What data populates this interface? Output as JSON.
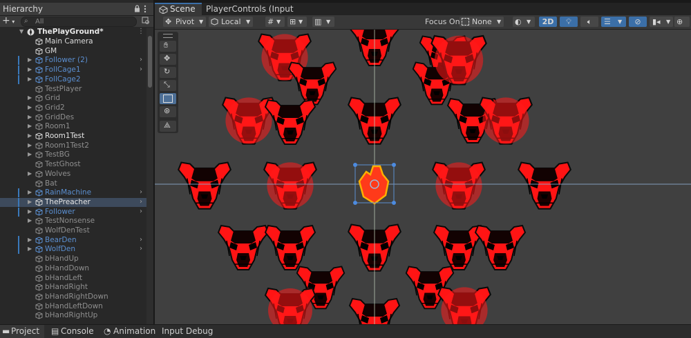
{
  "hierarchy": {
    "title": "Hierarchy",
    "add_label": "+",
    "search_placeholder": "All",
    "scene_name": "ThePlayGround*",
    "items": [
      {
        "label": "Main Camera",
        "style": "white"
      },
      {
        "label": "GM",
        "style": "white"
      },
      {
        "label": "Follower (2)",
        "style": "blue",
        "expand": true,
        "prefab": true
      },
      {
        "label": "FollCage1",
        "style": "blue",
        "expand": true,
        "prefab": true
      },
      {
        "label": "FollCage2",
        "style": "blue",
        "expand": false,
        "prefab": true
      },
      {
        "label": "TestPlayer",
        "style": "gray"
      },
      {
        "label": "Grid",
        "style": "gray",
        "expand": true
      },
      {
        "label": "Grid2",
        "style": "gray",
        "expand": true
      },
      {
        "label": "GridDes",
        "style": "gray",
        "expand": true
      },
      {
        "label": "Room1",
        "style": "gray",
        "expand": true
      },
      {
        "label": "Room1Test",
        "style": "bright",
        "expand": true
      },
      {
        "label": "Room1Test2",
        "style": "gray",
        "expand": true
      },
      {
        "label": "TestBG",
        "style": "gray",
        "expand": true
      },
      {
        "label": "TestGhost",
        "style": "gray"
      },
      {
        "label": "Wolves",
        "style": "gray",
        "expand": true
      },
      {
        "label": "Bat",
        "style": "gray"
      },
      {
        "label": "RainMachine",
        "style": "blue",
        "expand": true,
        "prefab": true
      },
      {
        "label": "ThePreacher",
        "style": "bright",
        "expand": true,
        "prefab": true,
        "selected": true
      },
      {
        "label": "Follower",
        "style": "blue",
        "expand": true,
        "prefab": true
      },
      {
        "label": "TestNonsense",
        "style": "gray",
        "expand": true
      },
      {
        "label": "WolfDenTest",
        "style": "gray"
      },
      {
        "label": "BearDen",
        "style": "blue",
        "expand": true,
        "prefab": true
      },
      {
        "label": "WolfDen",
        "style": "blue",
        "expand": true,
        "prefab": true
      },
      {
        "label": "bHandUp",
        "style": "gray"
      },
      {
        "label": "bHandDown",
        "style": "gray"
      },
      {
        "label": "bHandLeft",
        "style": "gray"
      },
      {
        "label": "bHandRight",
        "style": "gray"
      },
      {
        "label": "bHandRightDown",
        "style": "gray"
      },
      {
        "label": "bHandLeftDown",
        "style": "gray"
      },
      {
        "label": "bHandRightUp",
        "style": "gray"
      }
    ]
  },
  "scene_tabs": [
    {
      "label": "Scene",
      "active": true
    },
    {
      "label": "PlayerControls (Input Acti...",
      "active": false
    }
  ],
  "toolbar": {
    "pivot_label": "Pivot",
    "local_label": "Local",
    "focus_on_label": "Focus On",
    "none_label": "None",
    "mode_2d_label": "2D"
  },
  "bottom_tabs": [
    {
      "label": "Project",
      "icon": "folder-icon"
    },
    {
      "label": "Console",
      "icon": "console-icon"
    },
    {
      "label": "Animation",
      "icon": "animation-icon"
    },
    {
      "label": "Input Debug",
      "icon": ""
    }
  ],
  "colors": {
    "selection": "#3d4a5c",
    "prefab_blue": "#5b8fd1",
    "toggle_blue": "#3b6fa8",
    "hyena_red": "#ff1010",
    "viewport_bg": "#404040"
  }
}
